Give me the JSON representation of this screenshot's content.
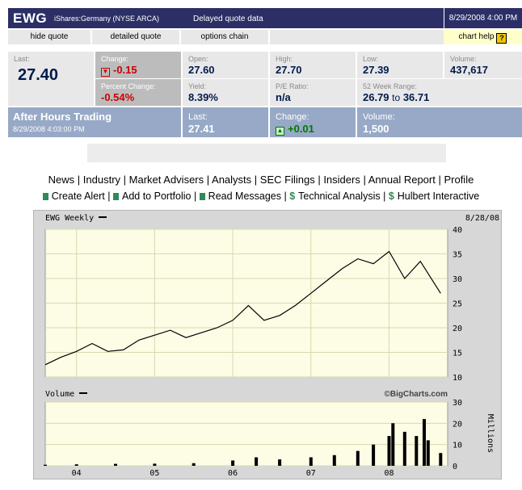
{
  "header": {
    "symbol": "EWG",
    "exchange": "iShares:Germany (NYSE ARCA)",
    "delay": "Delayed quote data",
    "datetime": "8/29/2008 4:00 PM"
  },
  "links": [
    "hide quote",
    "detailed quote",
    "options chain"
  ],
  "chart_help": "chart help",
  "quote": {
    "last_label": "Last:",
    "last": "27.40",
    "change_label": "Change:",
    "change": "-0.15",
    "pct_change_label": "Percent Change:",
    "pct_change": "-0.54%",
    "open_label": "Open:",
    "open": "27.60",
    "high_label": "High:",
    "high": "27.70",
    "low_label": "Low:",
    "low": "27.39",
    "volume_label": "Volume:",
    "volume": "437,617",
    "yield_label": "Yield:",
    "yield": "8.39%",
    "pe_label": "P/E Ratio:",
    "pe": "n/a",
    "range_label": "52 Week Range:",
    "range_low": "26.79",
    "range_to": "to",
    "range_high": "36.71"
  },
  "after_hours": {
    "title": "After Hours Trading",
    "time": "8/29/2008 4:03:00 PM",
    "last_label": "Last:",
    "last": "27.41",
    "change_label": "Change:",
    "change": "+0.01",
    "volume_label": "Volume:",
    "volume": "1,500"
  },
  "nav": [
    "News",
    "Industry",
    "Market Advisers",
    "Analysts",
    "SEC Filings",
    "Insiders",
    "Annual Report",
    "Profile"
  ],
  "actions": [
    {
      "label": "Create Alert",
      "icon": "doc-icon"
    },
    {
      "label": "Add to Portfolio",
      "icon": "doc-icon"
    },
    {
      "label": "Read Messages",
      "icon": "doc-icon"
    },
    {
      "label": "Technical Analysis",
      "icon": "dollar-icon"
    },
    {
      "label": "Hulbert Interactive",
      "icon": "dollar-icon"
    }
  ],
  "chart_data": [
    {
      "type": "line",
      "title": "EWG Weekly",
      "date_label": "8/28/08",
      "x_ticks": [
        "04",
        "05",
        "06",
        "07",
        "08"
      ],
      "y_ticks": [
        10,
        15,
        20,
        25,
        30,
        35,
        40
      ],
      "ylim": [
        10,
        40
      ],
      "credit": "©BigCharts.com",
      "series": [
        {
          "name": "EWG Weekly",
          "x": [
            2003.6,
            2003.8,
            2004.0,
            2004.2,
            2004.4,
            2004.6,
            2004.8,
            2005.0,
            2005.2,
            2005.4,
            2005.6,
            2005.8,
            2006.0,
            2006.2,
            2006.4,
            2006.6,
            2006.8,
            2007.0,
            2007.2,
            2007.4,
            2007.6,
            2007.8,
            2008.0,
            2008.2,
            2008.4,
            2008.66
          ],
          "values": [
            12.5,
            14.0,
            15.2,
            16.8,
            15.2,
            15.5,
            17.5,
            18.5,
            19.5,
            18.0,
            19.0,
            20.0,
            21.5,
            24.5,
            21.5,
            22.5,
            24.5,
            27.0,
            29.5,
            32.0,
            34.0,
            33.0,
            35.5,
            30.0,
            33.5,
            27.0
          ]
        }
      ]
    },
    {
      "type": "bar",
      "title": "Volume",
      "y_ticks": [
        0,
        10,
        20,
        30
      ],
      "ylim": [
        0,
        30
      ],
      "ylabel": "Millions",
      "series": [
        {
          "name": "Volume",
          "x": [
            2003.6,
            2004.0,
            2004.5,
            2005.0,
            2005.5,
            2006.0,
            2006.3,
            2006.6,
            2007.0,
            2007.3,
            2007.6,
            2007.8,
            2008.0,
            2008.05,
            2008.2,
            2008.35,
            2008.45,
            2008.5,
            2008.66
          ],
          "values": [
            0.5,
            0.7,
            0.9,
            1.0,
            1.2,
            2.5,
            4.0,
            3.0,
            4.0,
            5.0,
            7.0,
            10.0,
            14.0,
            20.0,
            16.0,
            14.0,
            22.0,
            12.0,
            6.0
          ]
        }
      ]
    }
  ]
}
